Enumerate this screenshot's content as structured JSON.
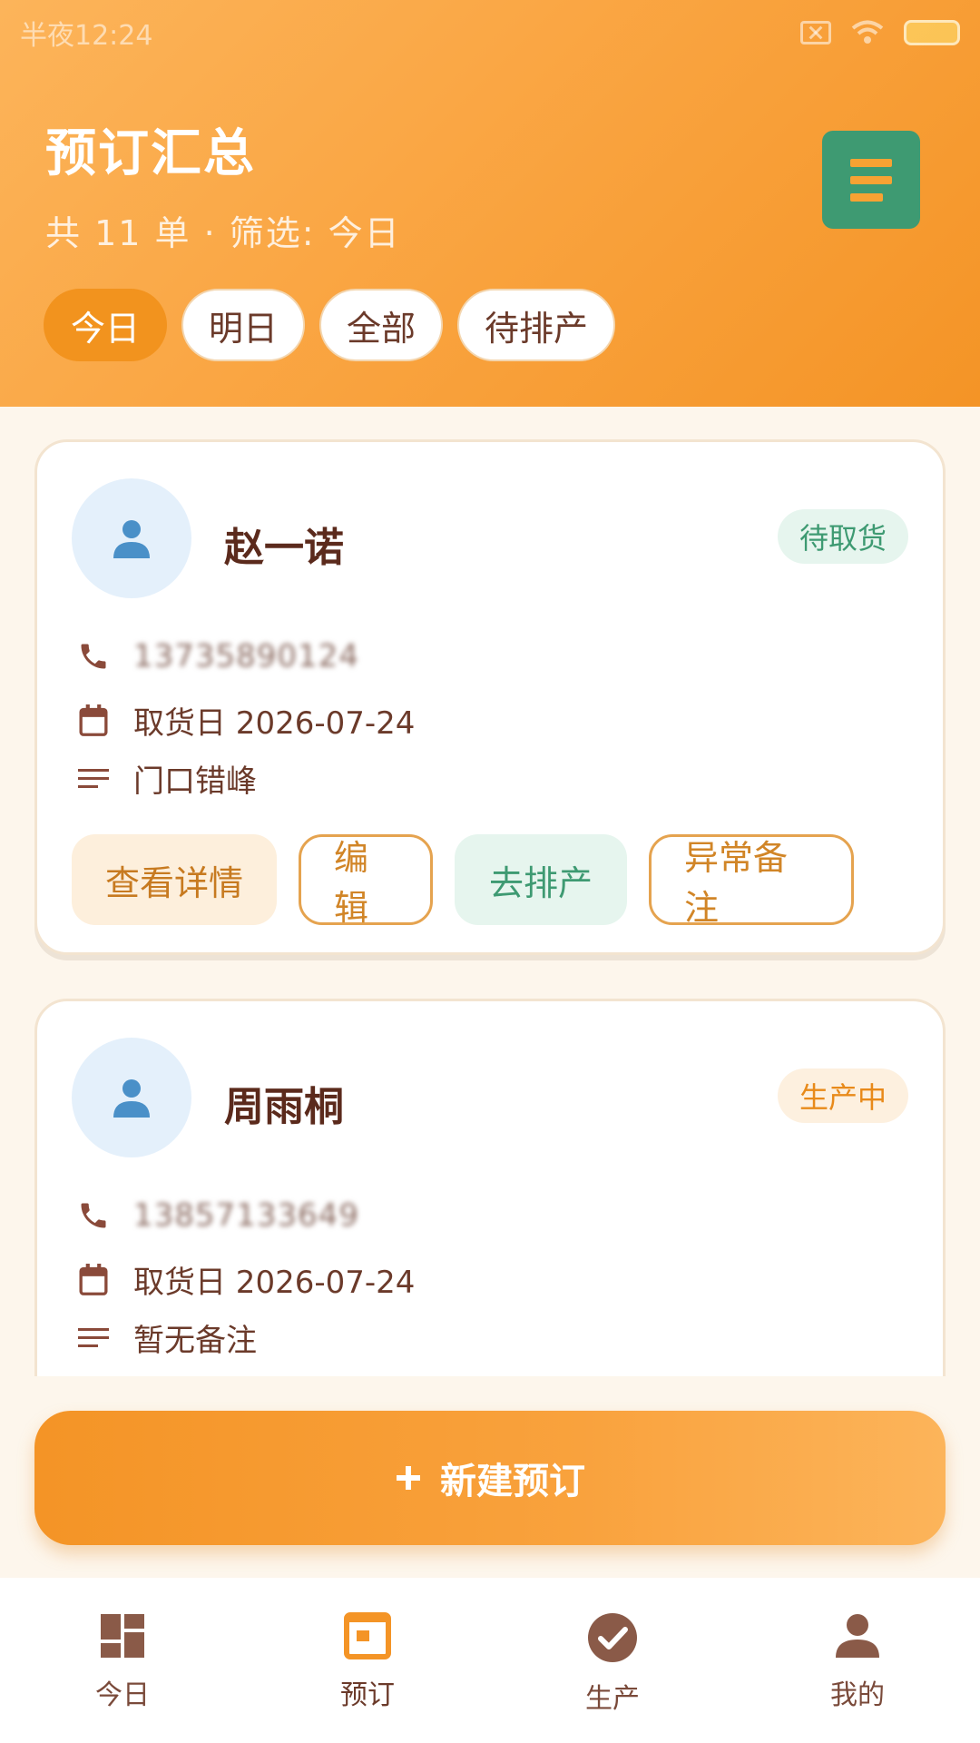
{
  "status_bar": {
    "time": "半夜12:24"
  },
  "header": {
    "title": "预订汇总",
    "subtitle": "共 11 单 · 筛选: 今日",
    "menu_icon": "list-icon"
  },
  "filters": [
    {
      "label": "今日",
      "active": true
    },
    {
      "label": "明日",
      "active": false
    },
    {
      "label": "全部",
      "active": false
    },
    {
      "label": "待排产",
      "active": false
    }
  ],
  "orders": [
    {
      "name": "赵一诺",
      "status": "待取货",
      "phone": "13735890124",
      "pickup": "取货日 2026-07-24",
      "note": "门口错峰",
      "actions": {
        "view": "查看详情",
        "edit": "编辑",
        "schedule": "去排产",
        "exception": "异常备注"
      }
    },
    {
      "name": "周雨桐",
      "status": "生产中",
      "phone": "13857133649",
      "pickup": "取货日 2026-07-24",
      "note": "暂无备注"
    }
  ],
  "new_order": {
    "icon": "plus-icon",
    "label": "新建预订"
  },
  "nav": [
    {
      "label": "今日",
      "icon": "dashboard-icon"
    },
    {
      "label": "预订",
      "icon": "order-icon"
    },
    {
      "label": "生产",
      "icon": "check-circle-icon"
    },
    {
      "label": "我的",
      "icon": "person-icon"
    }
  ],
  "colors": {
    "accent": "#f49426",
    "green": "#3e9a72",
    "brown": "#6b3a2a",
    "background": "#fdf6ec"
  }
}
